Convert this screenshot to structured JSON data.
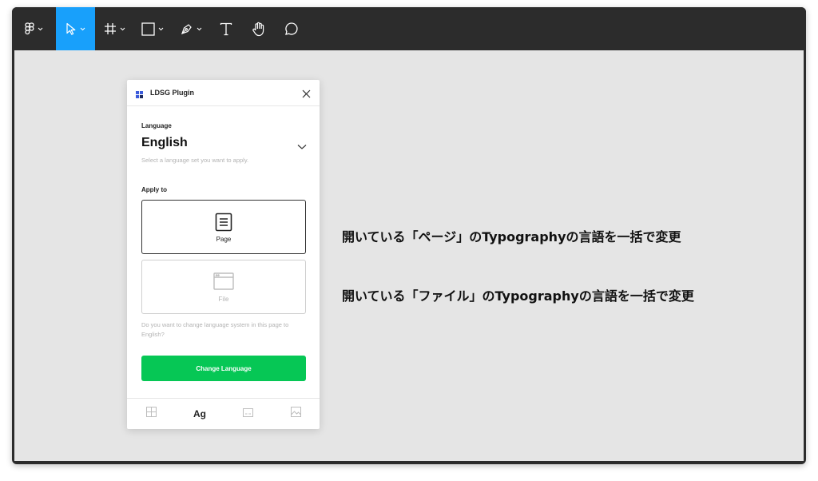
{
  "toolbar": {
    "tools": [
      {
        "name": "figma-menu",
        "icon": "figma-logo-icon",
        "has_dropdown": true
      },
      {
        "name": "move",
        "icon": "move-cursor-icon",
        "has_dropdown": true,
        "active": true
      },
      {
        "name": "frame",
        "icon": "frame-hash-icon",
        "has_dropdown": true
      },
      {
        "name": "rectangle",
        "icon": "rectangle-icon",
        "has_dropdown": true
      },
      {
        "name": "pen",
        "icon": "pen-icon",
        "has_dropdown": true
      },
      {
        "name": "text",
        "icon": "text-icon",
        "has_dropdown": false
      },
      {
        "name": "hand",
        "icon": "hand-icon",
        "has_dropdown": false
      },
      {
        "name": "comment",
        "icon": "comment-icon",
        "has_dropdown": false
      }
    ],
    "active_color": "#18a0fb"
  },
  "plugin": {
    "title": "LDSG Plugin",
    "language_label": "Language",
    "language_value": "English",
    "language_hint": "Select a language set you want to apply.",
    "apply_to_label": "Apply to",
    "options": [
      {
        "label": "Page",
        "icon": "page-icon",
        "selected": true
      },
      {
        "label": "File",
        "icon": "file-window-icon",
        "selected": false
      }
    ],
    "confirm_text": "Do you want to change language system in this page to English?",
    "button_label": "Change Language",
    "button_color": "#06c755",
    "tabs": [
      {
        "icon": "grid-icon",
        "label": ""
      },
      {
        "icon": "typography-icon",
        "label": "Ag"
      },
      {
        "icon": "image-placeholder-icon",
        "label": ""
      },
      {
        "icon": "picture-icon",
        "label": ""
      }
    ]
  },
  "annotations": {
    "page": "開いている「ページ」のTypographyの言語を一括で変更",
    "file": "開いている「ファイル」のTypographyの言語を一括で変更"
  }
}
